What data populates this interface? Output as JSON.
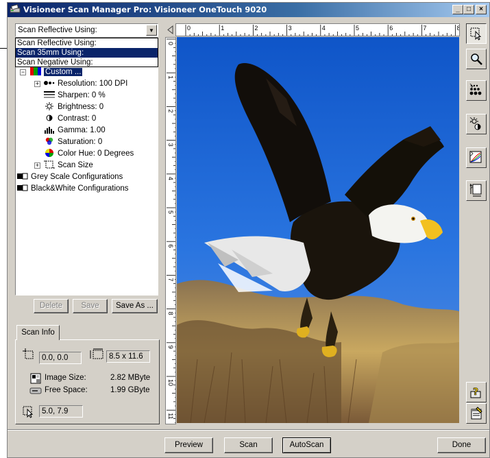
{
  "window": {
    "title": "Visioneer Scan Manager Pro:  Visioneer OneTouch 9020",
    "minimize": "_",
    "maximize": "□",
    "close": "×"
  },
  "scan_mode": {
    "selected": "Scan Reflective Using:",
    "options": [
      "Scan Reflective Using:",
      "Scan 35mm Using:",
      "Scan Negative Using:"
    ],
    "highlighted_index": 1
  },
  "tree": {
    "custom": "Custom ...",
    "settings": [
      {
        "label": "Resolution: 100 DPI",
        "icon": "resolution-icon",
        "expandable": true
      },
      {
        "label": "Sharpen: 0 %",
        "icon": "sharpen-icon",
        "expandable": false
      },
      {
        "label": "Brightness: 0",
        "icon": "brightness-icon",
        "expandable": false
      },
      {
        "label": "Contrast: 0",
        "icon": "contrast-icon",
        "expandable": false
      },
      {
        "label": "Gamma: 1.00",
        "icon": "gamma-icon",
        "expandable": false
      },
      {
        "label": "Saturation: 0",
        "icon": "saturation-icon",
        "expandable": false
      },
      {
        "label": "Color Hue: 0 Degrees",
        "icon": "color-hue-icon",
        "expandable": false
      },
      {
        "label": "Scan Size",
        "icon": "scan-size-icon",
        "expandable": true
      }
    ],
    "groups": [
      "Grey Scale Configurations",
      "Black&White Configurations"
    ]
  },
  "config_buttons": {
    "delete": "Delete",
    "save": "Save",
    "save_as": "Save As ..."
  },
  "scan_info": {
    "tab": "Scan Info",
    "origin": "0.0, 0.0",
    "size": "8.5 x 11.6",
    "image_size_label": "Image Size:",
    "image_size_value": "2.82 MByte",
    "free_space_label": "Free Space:",
    "free_space_value": "1.99 GByte",
    "cursor": "5.0, 7.9"
  },
  "rulers": {
    "top": [
      "0",
      "1",
      "2",
      "3",
      "4",
      "5",
      "6",
      "7",
      "8"
    ],
    "left": [
      "0",
      "1",
      "2",
      "3",
      "4",
      "5",
      "6",
      "7",
      "8",
      "9",
      "10",
      "11"
    ]
  },
  "bottom_buttons": {
    "preview": "Preview",
    "scan": "Scan",
    "autoscan": "AutoScan",
    "done": "Done"
  }
}
